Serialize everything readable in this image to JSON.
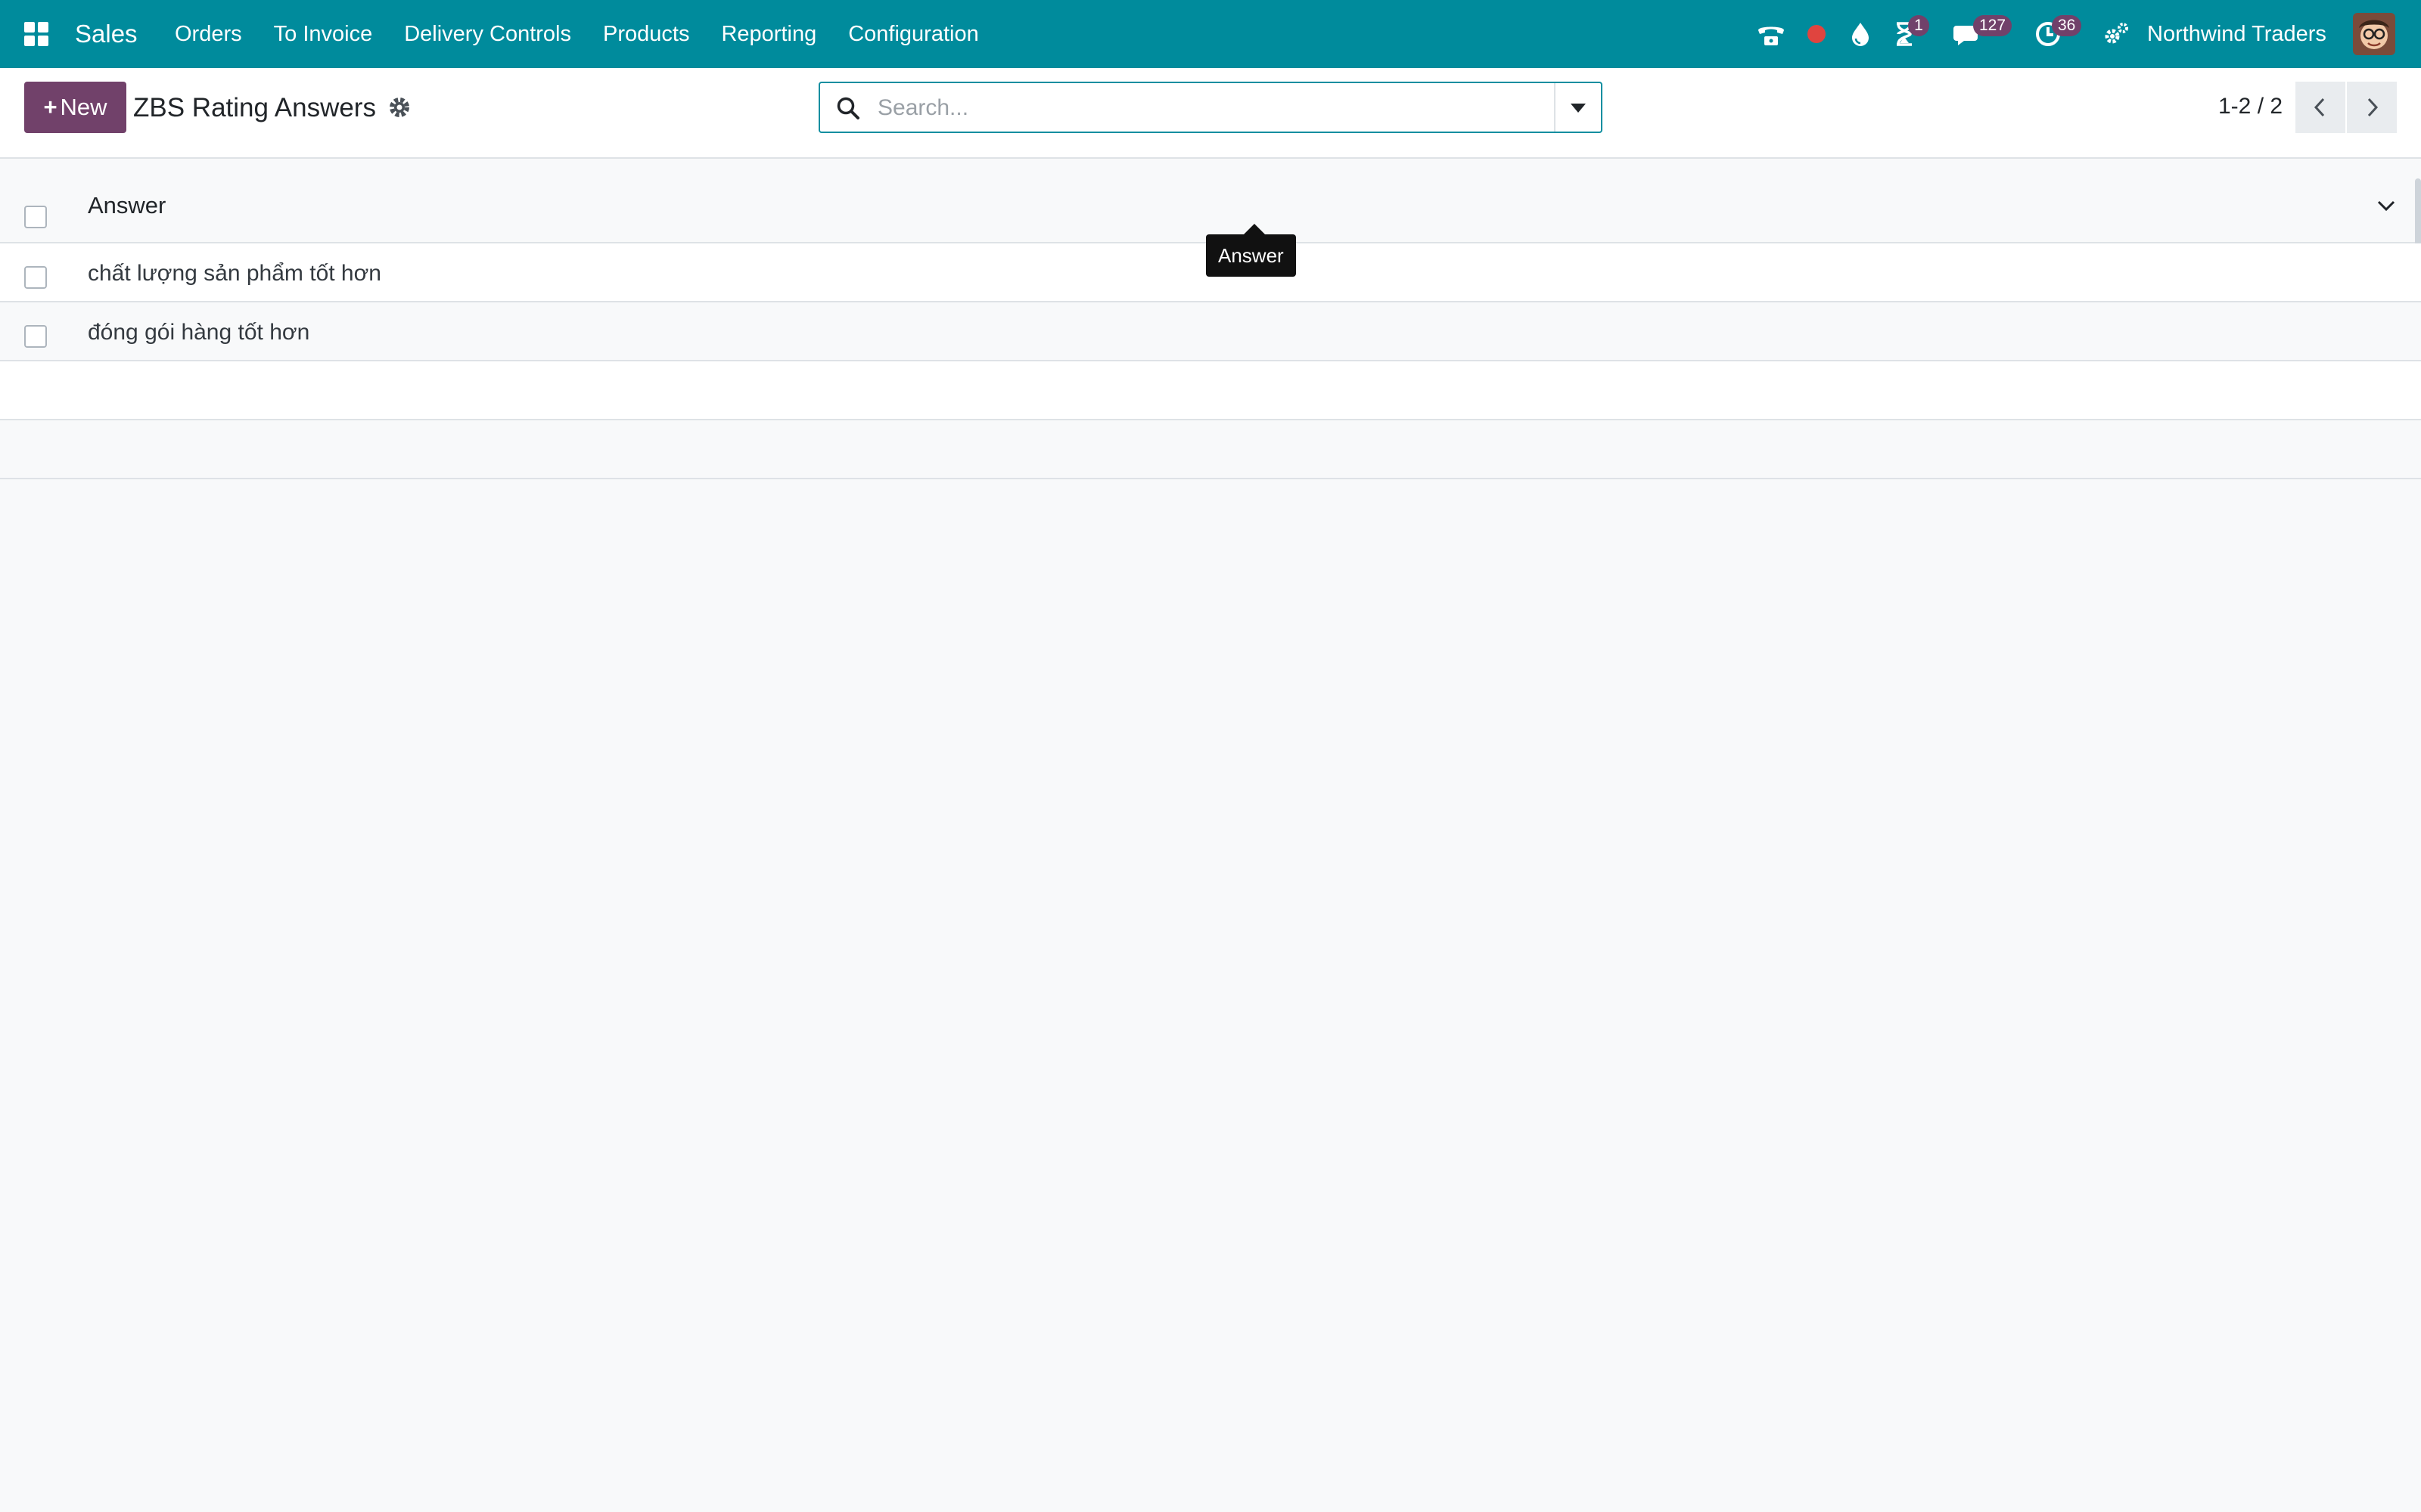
{
  "navbar": {
    "app_name": "Sales",
    "menu": [
      "Orders",
      "To Invoice",
      "Delivery Controls",
      "Products",
      "Reporting",
      "Configuration"
    ],
    "activity_badge": "1",
    "messages_badge": "127",
    "clock_badge": "36",
    "company": "Northwind Traders"
  },
  "control_panel": {
    "new_label": "New",
    "title": "ZBS Rating Answers",
    "search_placeholder": "Search...",
    "pager": "1-2 / 2"
  },
  "list": {
    "column_header": "Answer",
    "rows": [
      "chất lượng sản phẩm tốt hơn",
      "đóng gói hàng tốt hơn"
    ]
  },
  "tooltip": "Answer",
  "colors": {
    "navbar_bg": "#008b9c",
    "primary": "#71416a",
    "badge": "#71416a",
    "record_dot": "#e0443f"
  }
}
